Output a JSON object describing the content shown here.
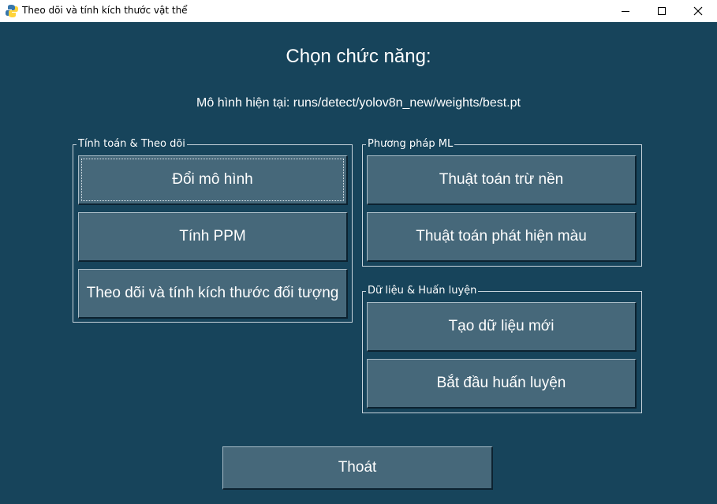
{
  "window": {
    "title": "Theo dõi và tính kích thước vật thể"
  },
  "heading": "Chọn chức năng:",
  "model_info": "Mô hình hiện tại: runs/detect/yolov8n_new/weights/best.pt",
  "groups": {
    "calc": {
      "label": "Tính toán & Theo dõi",
      "buttons": [
        "Đổi mô hình",
        "Tính PPM",
        "Theo dõi và tính kích thước đối tượng"
      ]
    },
    "ml": {
      "label": "Phương pháp ML",
      "buttons": [
        "Thuật toán trừ nền",
        "Thuật toán phát hiện màu"
      ]
    },
    "data": {
      "label": "Dữ liệu & Huấn luyện",
      "buttons": [
        "Tạo dữ liệu mới",
        "Bắt đầu huấn luyện"
      ]
    }
  },
  "exit_label": "Thoát",
  "colors": {
    "background": "#17445b",
    "button": "#46687a",
    "text": "#ffffff"
  }
}
